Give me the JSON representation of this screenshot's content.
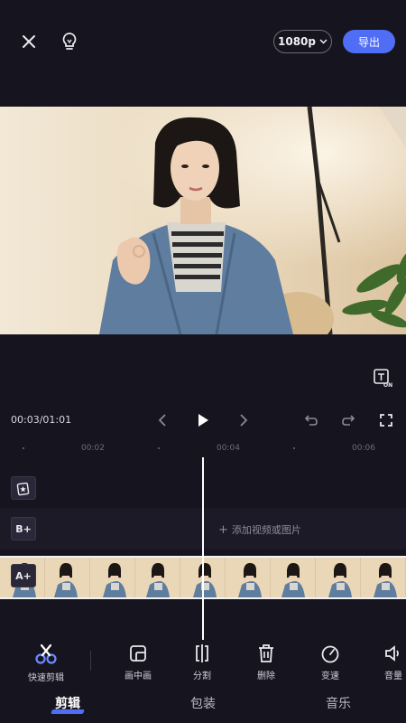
{
  "topbar": {
    "close_icon": "close-icon",
    "tips_icon": "lightbulb-icon",
    "resolution": "1080p",
    "export_label": "导出"
  },
  "preview": {
    "caption_toggle_icon": "text-on-icon"
  },
  "playback": {
    "time": "00:03/01:01",
    "icons": [
      "prev-icon",
      "play-icon",
      "next-icon",
      "undo-icon",
      "redo-icon",
      "fullscreen-icon"
    ]
  },
  "ruler": {
    "ticks": [
      "00:02",
      "00:04",
      "00:06"
    ]
  },
  "tracks": {
    "sticker_icon": "sticker-star-icon",
    "track_b_label": "B+",
    "add_media_label": "添加视频或图片",
    "track_a_label": "A+"
  },
  "tools": [
    {
      "label": "快速剪辑",
      "icon": "scissors-icon"
    },
    {
      "label": "画中画",
      "icon": "picture-in-picture-icon"
    },
    {
      "label": "分割",
      "icon": "split-icon"
    },
    {
      "label": "删除",
      "icon": "trash-icon"
    },
    {
      "label": "变速",
      "icon": "speed-gauge-icon"
    },
    {
      "label": "音量",
      "icon": "volume-icon"
    }
  ],
  "tabs": [
    {
      "label": "剪辑",
      "active": true
    },
    {
      "label": "包装",
      "active": false
    },
    {
      "label": "音乐",
      "active": false
    }
  ],
  "colors": {
    "background": "#16141f",
    "accent": "#4f6df5"
  }
}
